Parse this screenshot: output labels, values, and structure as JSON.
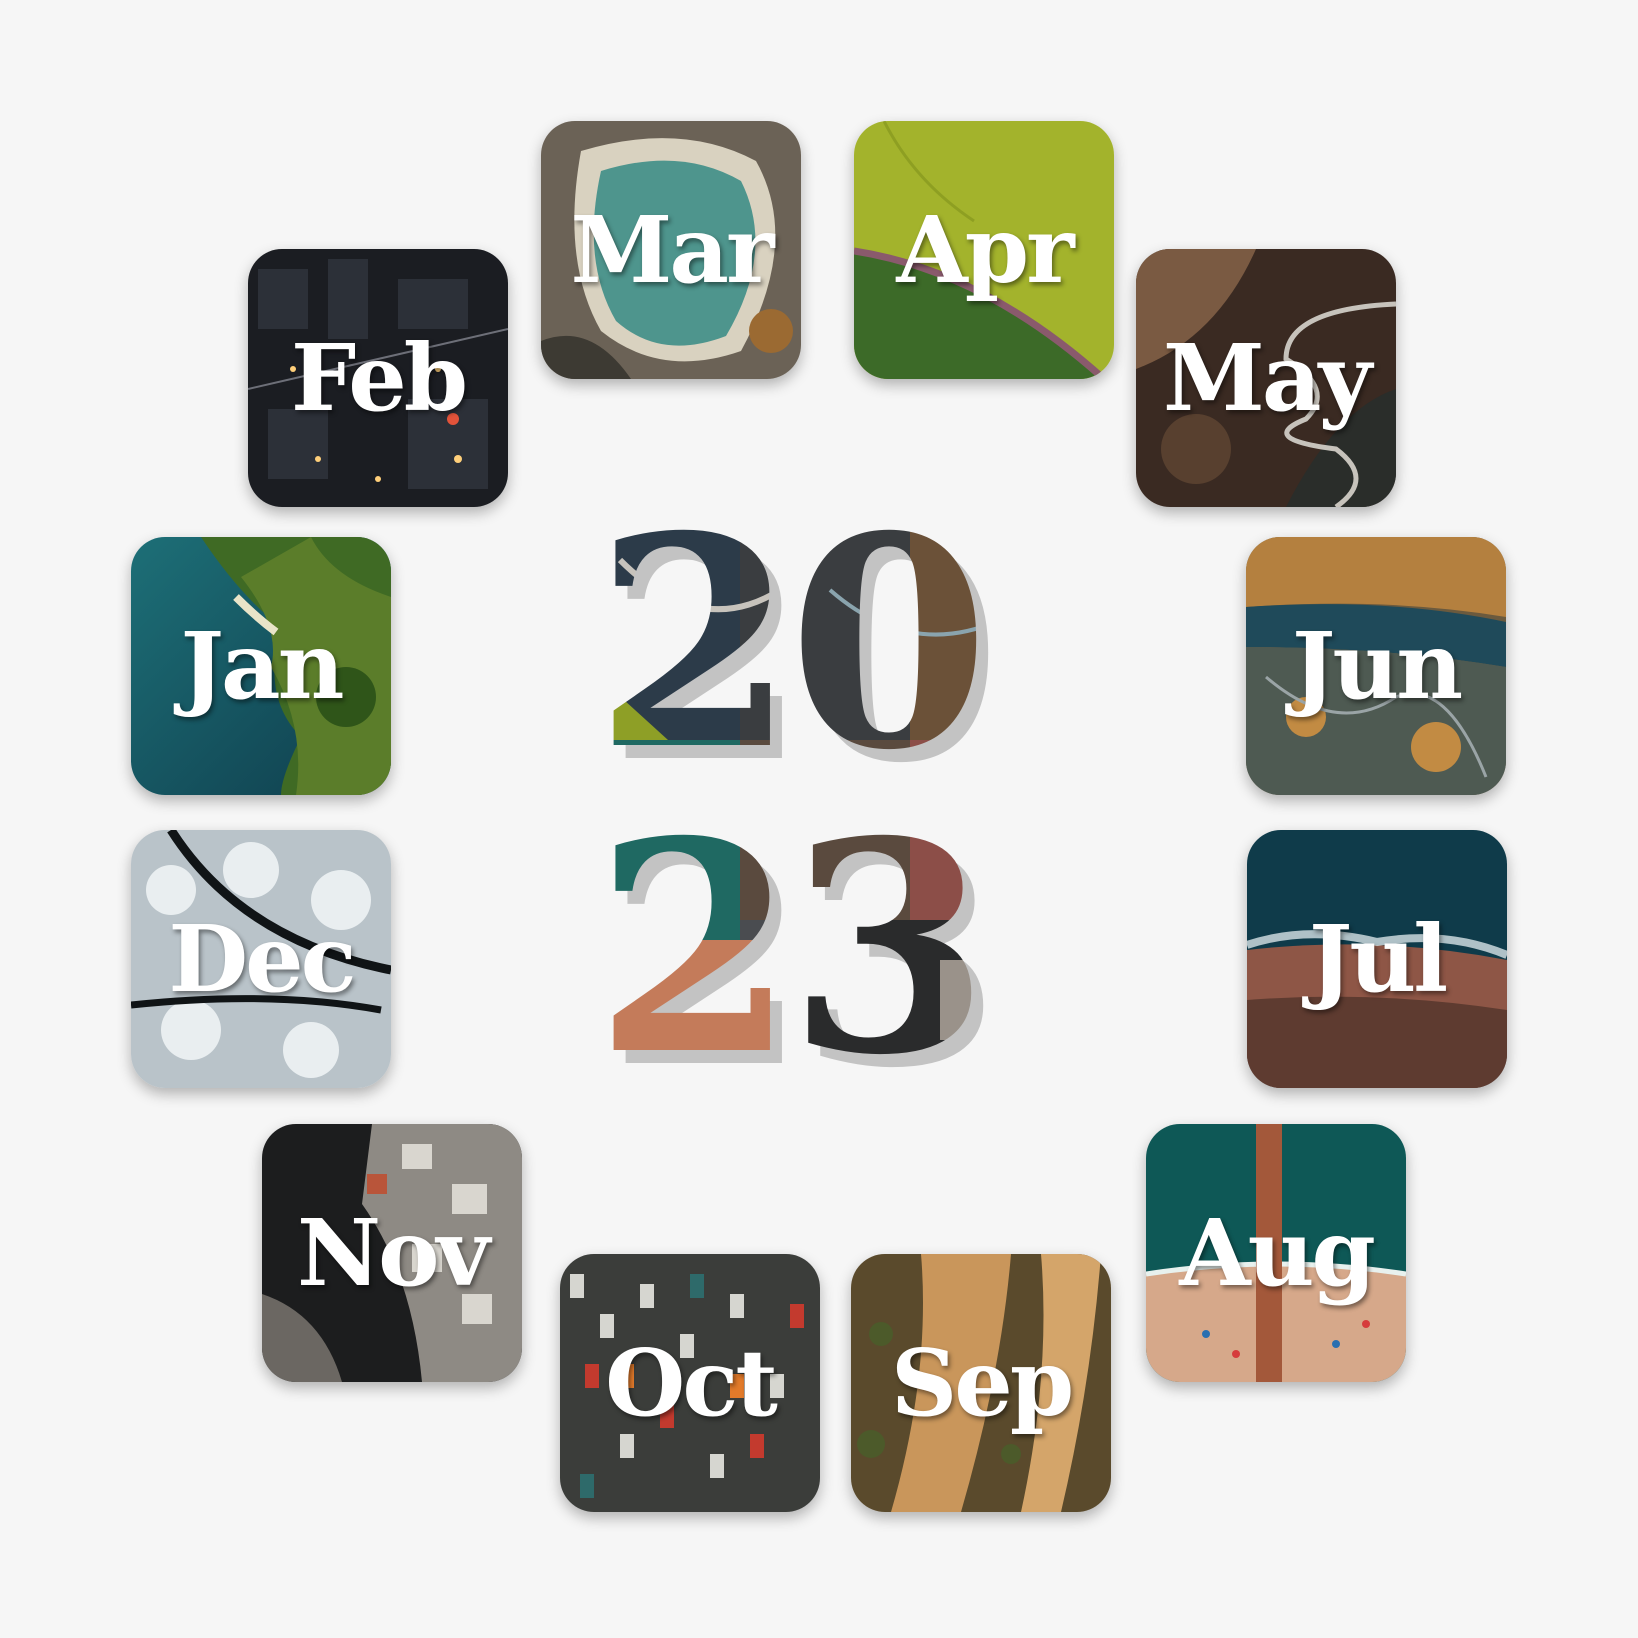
{
  "months": {
    "jan": "Jan",
    "feb": "Feb",
    "mar": "Mar",
    "apr": "Apr",
    "may": "May",
    "jun": "Jun",
    "jul": "Jul",
    "aug": "Aug",
    "sep": "Sep",
    "oct": "Oct",
    "nov": "Nov",
    "dec": "Dec"
  },
  "year": {
    "top": "20",
    "bottom": "23"
  },
  "colors": {
    "background": "#f6f6f6",
    "label": "#ffffff"
  }
}
